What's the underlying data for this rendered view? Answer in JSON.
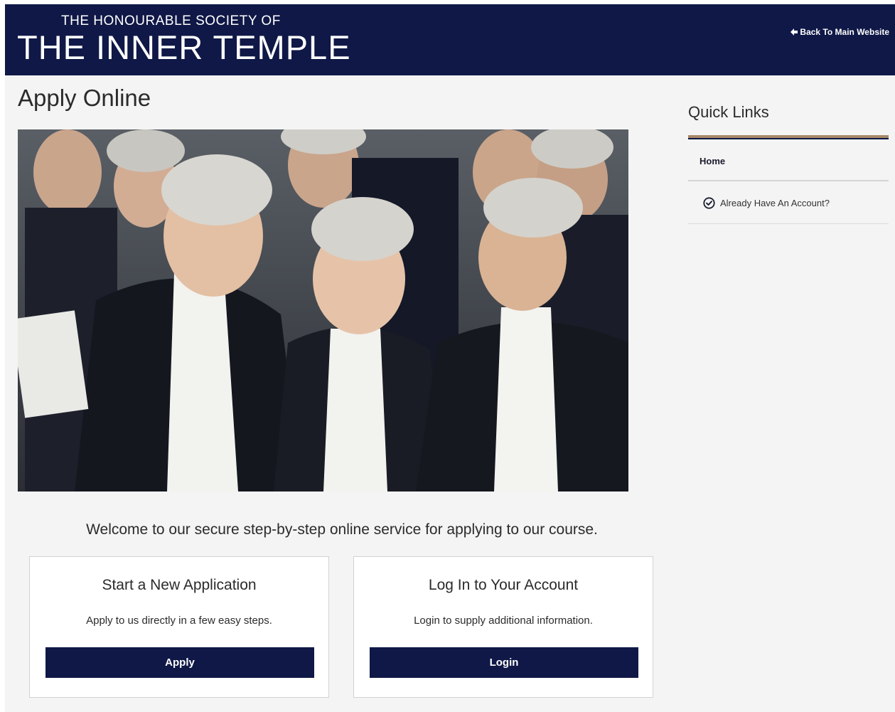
{
  "header": {
    "brand_small": "THE HONOURABLE SOCIETY OF",
    "brand_big": "THE INNER TEMPLE",
    "back_link": "Back To Main Website",
    "back_icon": "arrow-left-icon",
    "bg_color": "#0f1846"
  },
  "main": {
    "title": "Apply Online",
    "hero_image": "barristers-in-wigs-photo",
    "welcome": "Welcome to our secure step-by-step online service for applying to our course.",
    "cards": [
      {
        "title": "Start a New Application",
        "description": "Apply to us directly in a few easy steps.",
        "button": "Apply"
      },
      {
        "title": "Log In to Your Account",
        "description": "Login to supply additional information.",
        "button": "Login"
      }
    ]
  },
  "sidebar": {
    "title": "Quick Links",
    "accent_color": "#a8886a",
    "items": [
      {
        "label": "Home"
      },
      {
        "label": "Already Have An Account?",
        "icon": "check-circle-icon"
      }
    ]
  }
}
